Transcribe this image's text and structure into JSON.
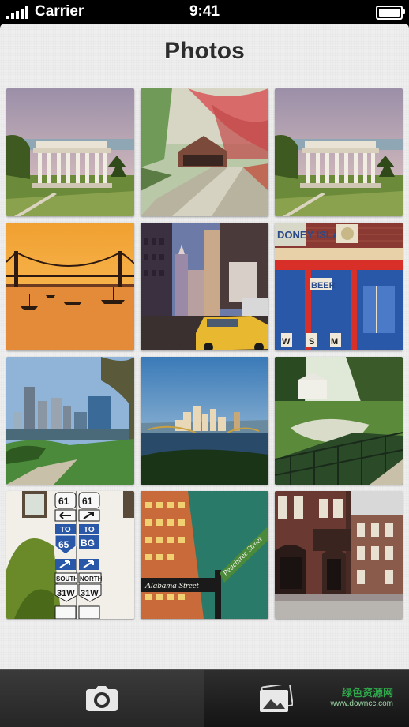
{
  "status_bar": {
    "carrier": "Carrier",
    "time": "9:41"
  },
  "page": {
    "title": "Photos"
  },
  "photos": [
    {
      "name": "photo-colonnade-park"
    },
    {
      "name": "photo-covered-bridge-road"
    },
    {
      "name": "photo-colonnade-park-2"
    },
    {
      "name": "photo-suspension-bridge-sunset"
    },
    {
      "name": "photo-city-street-taxi"
    },
    {
      "name": "photo-coney-island-storefront",
      "signs": [
        "DONEY ISLA",
        "BEER",
        "W",
        "S",
        "M"
      ]
    },
    {
      "name": "photo-city-skyline-park"
    },
    {
      "name": "photo-pittsburgh-skyline"
    },
    {
      "name": "photo-park-fence"
    },
    {
      "name": "photo-highway-signs",
      "signs": [
        "61",
        "61",
        "TO",
        "TO",
        "65",
        "BG",
        "SOUTH",
        "NORTH",
        "31W",
        "31W"
      ]
    },
    {
      "name": "photo-street-signs",
      "signs": [
        "Alabama Street",
        "Peachtree Street"
      ]
    },
    {
      "name": "photo-brick-rowhouses"
    }
  ],
  "tab_bar": {
    "camera_icon": "camera-icon",
    "library_icon": "photo-library-icon"
  },
  "watermark": {
    "main": "绿色资源网",
    "url": "www.downcc.com"
  },
  "colors": {
    "background": "#eeeeee",
    "title": "#2d2d2d",
    "tab_bar": "#2a2a2a"
  }
}
